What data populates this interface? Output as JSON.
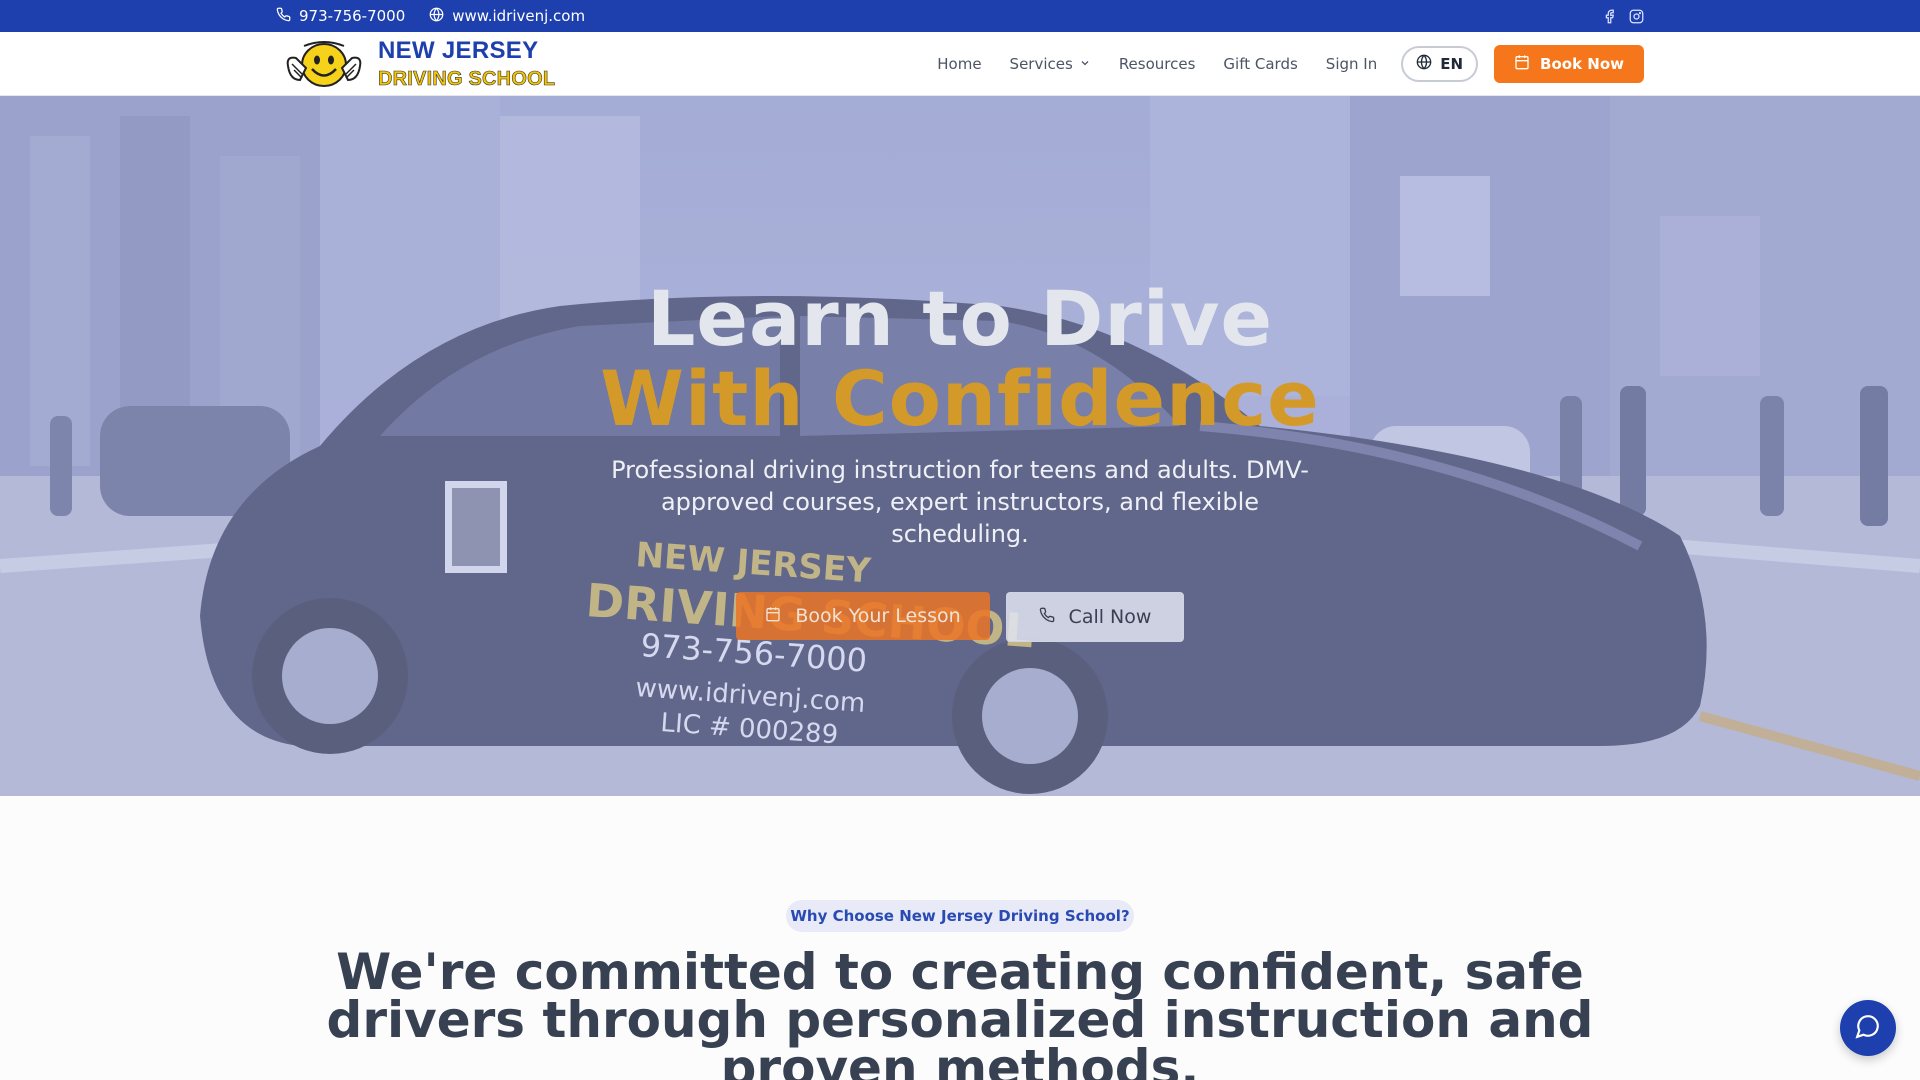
{
  "topbar": {
    "phone": "973-756-7000",
    "website": "www.idrivenj.com",
    "social": [
      "facebook-icon",
      "instagram-icon"
    ]
  },
  "header": {
    "logo_line1": "NEW JERSEY",
    "logo_line2": "DRIVING SCHOOL",
    "nav": {
      "home": "Home",
      "services": "Services",
      "resources": "Resources",
      "gift_cards": "Gift Cards",
      "sign_in": "Sign In"
    },
    "language": "EN",
    "book_now": "Book Now"
  },
  "hero": {
    "title_line1": "Learn to Drive",
    "title_line2": "With Confidence",
    "subtitle": "Professional driving instruction for teens and adults. DMV-approved courses, expert instructors, and flexible scheduling.",
    "primary_button": "Book Your Lesson",
    "secondary_button": "Call Now",
    "car_text": {
      "line1": "NEW JERSEY",
      "line2": "DRIVING SCHOOL",
      "phone": "973-756-7000",
      "web": "www.idrivenj.com",
      "license": "LIC # 000289"
    }
  },
  "why": {
    "badge": "Why Choose New Jersey Driving School?",
    "heading": "We're committed to creating confident, safe drivers through personalized instruction and proven methods."
  },
  "colors": {
    "brand_blue": "#1d40ae",
    "accent_orange": "#f6761b",
    "logo_yellow": "#f4c400"
  }
}
